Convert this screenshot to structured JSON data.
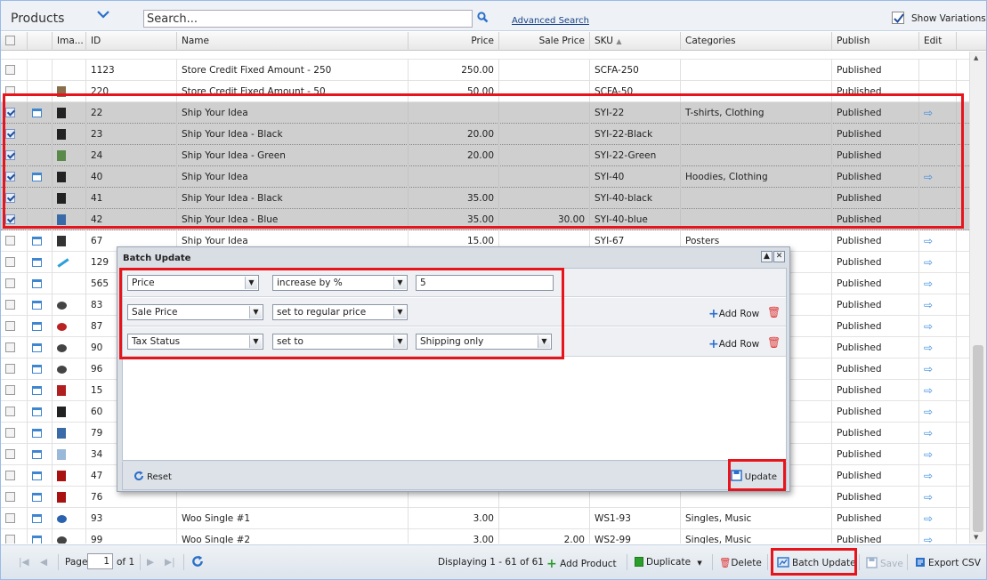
{
  "header": {
    "title": "Products",
    "search_placeholder": "Search...",
    "advanced_search": "Advanced Search",
    "show_variations": "Show Variations"
  },
  "columns": {
    "image": "Ima...",
    "id": "ID",
    "name": "Name",
    "price": "Price",
    "sale_price": "Sale Price",
    "sku": "SKU",
    "categories": "Categories",
    "publish": "Publish",
    "edit": "Edit"
  },
  "rows": [
    {
      "checked": false,
      "parent": false,
      "img": "none",
      "id": "1123",
      "name": "Store Credit Fixed Amount - 250",
      "price": "250.00",
      "sale": "",
      "sku": "SCFA-250",
      "cat": "",
      "pub": "Published",
      "edit": false
    },
    {
      "checked": false,
      "parent": false,
      "img": "bag",
      "id": "220",
      "name": "Store Credit Fixed Amount - 50",
      "price": "50.00",
      "sale": "",
      "sku": "SCFA-50",
      "cat": "",
      "pub": "Published",
      "edit": false
    },
    {
      "checked": true,
      "parent": true,
      "img": "tshirt-black",
      "id": "22",
      "name": "Ship Your Idea",
      "price": "",
      "sale": "",
      "sku": "SYI-22",
      "cat": "T-shirts, Clothing",
      "pub": "Published",
      "edit": true
    },
    {
      "checked": true,
      "parent": false,
      "img": "tshirt-black",
      "id": "23",
      "name": "Ship Your Idea - Black",
      "price": "20.00",
      "sale": "",
      "sku": "SYI-22-Black",
      "cat": "",
      "pub": "Published",
      "edit": false
    },
    {
      "checked": true,
      "parent": false,
      "img": "tshirt-green",
      "id": "24",
      "name": "Ship Your Idea - Green",
      "price": "20.00",
      "sale": "",
      "sku": "SYI-22-Green",
      "cat": "",
      "pub": "Published",
      "edit": false
    },
    {
      "checked": true,
      "parent": true,
      "img": "hoodie-black",
      "id": "40",
      "name": "Ship Your Idea",
      "price": "",
      "sale": "",
      "sku": "SYI-40",
      "cat": "Hoodies, Clothing",
      "pub": "Published",
      "edit": true
    },
    {
      "checked": true,
      "parent": false,
      "img": "hoodie-black",
      "id": "41",
      "name": "Ship Your Idea - Black",
      "price": "35.00",
      "sale": "",
      "sku": "SYI-40-black",
      "cat": "",
      "pub": "Published",
      "edit": false
    },
    {
      "checked": true,
      "parent": false,
      "img": "hoodie-blue",
      "id": "42",
      "name": "Ship Your Idea - Blue",
      "price": "35.00",
      "sale": "30.00",
      "sku": "SYI-40-blue",
      "cat": "",
      "pub": "Published",
      "edit": false
    },
    {
      "checked": false,
      "parent": true,
      "img": "poster",
      "id": "67",
      "name": "Ship Your Idea",
      "price": "15.00",
      "sale": "",
      "sku": "SYI-67",
      "cat": "Posters",
      "pub": "Published",
      "edit": true
    },
    {
      "checked": false,
      "parent": true,
      "img": "pen",
      "id": "129",
      "name": "",
      "price": "",
      "sale": "",
      "sku": "",
      "cat": "",
      "pub": "Published",
      "edit": true
    },
    {
      "checked": false,
      "parent": true,
      "img": "none",
      "id": "565",
      "name": "",
      "price": "",
      "sale": "",
      "sku": "",
      "cat": "",
      "pub": "Published",
      "edit": true
    },
    {
      "checked": false,
      "parent": true,
      "img": "cd",
      "id": "83",
      "name": "",
      "price": "",
      "sale": "",
      "sku": "",
      "cat": "",
      "pub": "Published",
      "edit": true
    },
    {
      "checked": false,
      "parent": true,
      "img": "cd-red",
      "id": "87",
      "name": "",
      "price": "",
      "sale": "",
      "sku": "",
      "cat": "",
      "pub": "Published",
      "edit": true
    },
    {
      "checked": false,
      "parent": true,
      "img": "cd",
      "id": "90",
      "name": "",
      "price": "",
      "sale": "",
      "sku": "",
      "cat": "",
      "pub": "Published",
      "edit": true
    },
    {
      "checked": false,
      "parent": true,
      "img": "cd",
      "id": "96",
      "name": "",
      "price": "",
      "sale": "",
      "sku": "",
      "cat": "",
      "pub": "Published",
      "edit": true
    },
    {
      "checked": false,
      "parent": true,
      "img": "tshirt-red",
      "id": "15",
      "name": "",
      "price": "",
      "sale": "",
      "sku": "",
      "cat": "",
      "pub": "Published",
      "edit": true
    },
    {
      "checked": false,
      "parent": true,
      "img": "hoodie-black",
      "id": "60",
      "name": "",
      "price": "",
      "sale": "",
      "sku": "",
      "cat": "",
      "pub": "Published",
      "edit": true
    },
    {
      "checked": false,
      "parent": true,
      "img": "hoodie-blue",
      "id": "79",
      "name": "",
      "price": "",
      "sale": "",
      "sku": "",
      "cat": "",
      "pub": "Published",
      "edit": true
    },
    {
      "checked": false,
      "parent": true,
      "img": "tshirt-light",
      "id": "34",
      "name": "",
      "price": "",
      "sale": "",
      "sku": "",
      "cat": "",
      "pub": "Published",
      "edit": true
    },
    {
      "checked": false,
      "parent": true,
      "img": "hoodie-red",
      "id": "47",
      "name": "",
      "price": "",
      "sale": "",
      "sku": "",
      "cat": "",
      "pub": "Published",
      "edit": true
    },
    {
      "checked": false,
      "parent": true,
      "img": "hoodie-red",
      "id": "76",
      "name": "",
      "price": "",
      "sale": "",
      "sku": "",
      "cat": "",
      "pub": "Published",
      "edit": true
    },
    {
      "checked": false,
      "parent": true,
      "img": "cd-blue",
      "id": "93",
      "name": "Woo Single #1",
      "price": "3.00",
      "sale": "",
      "sku": "WS1-93",
      "cat": "Singles, Music",
      "pub": "Published",
      "edit": true
    },
    {
      "checked": false,
      "parent": true,
      "img": "cd",
      "id": "99",
      "name": "Woo Single #2",
      "price": "3.00",
      "sale": "2.00",
      "sku": "WS2-99",
      "cat": "Singles, Music",
      "pub": "Published",
      "edit": true
    }
  ],
  "dialog": {
    "title": "Batch Update",
    "rows": [
      {
        "field": "Price",
        "action": "increase by %",
        "value": "5",
        "add_row": ""
      },
      {
        "field": "Sale Price",
        "action": "set to regular price",
        "value": "",
        "add_row": "Add Row"
      },
      {
        "field": "Tax Status",
        "action": "set to",
        "value": "Shipping only",
        "add_row": "Add Row"
      }
    ],
    "reset": "Reset",
    "update": "Update"
  },
  "footer": {
    "page_label": "Page",
    "page_value": "1",
    "of_label": "of 1",
    "displaying": "Displaying 1 - 61 of 61",
    "add_product": "Add Product",
    "duplicate": "Duplicate",
    "delete": "Delete",
    "batch_update": "Batch Update",
    "save": "Save",
    "export_csv": "Export CSV"
  },
  "colors": {
    "highlight": "#e8141c",
    "accent": "#3b8de0",
    "selected_row": "#cfcfcf"
  }
}
